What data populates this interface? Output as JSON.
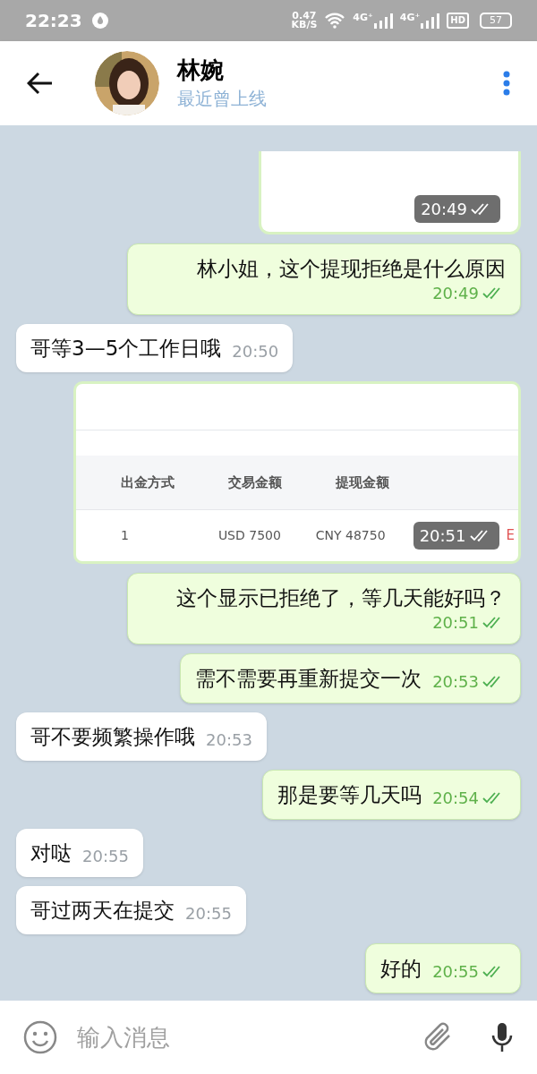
{
  "status_bar": {
    "time": "22:23",
    "speed_value": "0.47",
    "speed_unit": "KB/S",
    "network_labels": [
      "4G⁺",
      "4G⁺"
    ],
    "hd_label": "HD",
    "battery": "57"
  },
  "header": {
    "name": "林婉",
    "status": "最近曾上线"
  },
  "messages": [
    {
      "outgoing": true,
      "time": "20:49",
      "read": true
    },
    {
      "kind": "text",
      "outgoing": true,
      "text": "林小姐，这个提现拒绝是什么原因",
      "time": "20:49",
      "read": true
    },
    {
      "kind": "text",
      "outgoing": false,
      "text": "哥等3—5个工作日哦",
      "time": "20:50"
    },
    {
      "kind": "table",
      "outgoing": true,
      "time": "20:51",
      "read": true,
      "table": {
        "columns": [
          "出金方式",
          "交易金额",
          "提现金额"
        ],
        "rows": [
          [
            "1",
            "USD 7500",
            "CNY 48750",
            "E"
          ]
        ]
      }
    },
    {
      "kind": "text",
      "outgoing": true,
      "text": "这个显示已拒绝了，等几天能好吗？",
      "time": "20:51",
      "read": true
    },
    {
      "kind": "text",
      "outgoing": true,
      "text": "需不需要再重新提交一次",
      "time": "20:53",
      "read": true
    },
    {
      "kind": "text",
      "outgoing": false,
      "text": "哥不要频繁操作哦",
      "time": "20:53"
    },
    {
      "kind": "text",
      "outgoing": true,
      "text": "那是要等几天吗",
      "time": "20:54",
      "read": true
    },
    {
      "kind": "text",
      "outgoing": false,
      "text": "对哒",
      "time": "20:55"
    },
    {
      "kind": "text",
      "outgoing": false,
      "text": "哥过两天在提交",
      "time": "20:55"
    },
    {
      "kind": "text",
      "outgoing": true,
      "text": "好的",
      "time": "20:55",
      "read": true
    }
  ],
  "composer": {
    "placeholder": "输入消息"
  }
}
